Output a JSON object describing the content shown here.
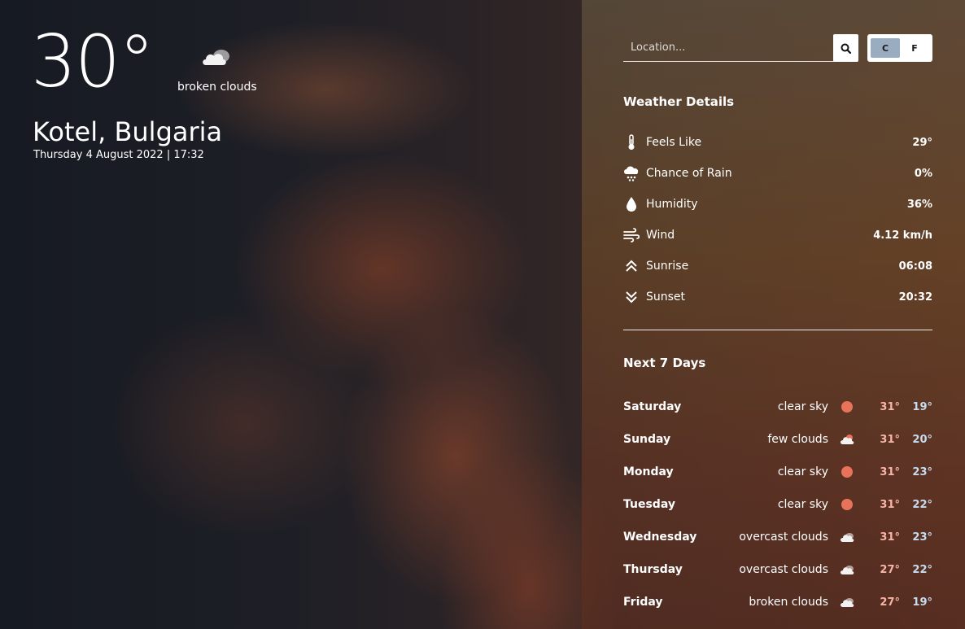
{
  "current": {
    "temperature": "30°",
    "condition": "broken clouds",
    "condition_icon": "cloud-icon",
    "location": "Kotel, Bulgaria",
    "datetime": "Thursday 4 August 2022 | 17:32"
  },
  "search": {
    "placeholder": "Location..."
  },
  "units": {
    "celsius": "C",
    "fahrenheit": "F",
    "active": "C",
    "active_color": "#9aacc0"
  },
  "details": {
    "title": "Weather Details",
    "items": [
      {
        "icon": "thermometer-icon",
        "label": "Feels Like",
        "value": "29°"
      },
      {
        "icon": "rain-cloud-icon",
        "label": "Chance of Rain",
        "value": "0%"
      },
      {
        "icon": "droplet-icon",
        "label": "Humidity",
        "value": "36%"
      },
      {
        "icon": "wind-icon",
        "label": "Wind",
        "value": "4.12 km/h"
      },
      {
        "icon": "sunrise-icon",
        "label": "Sunrise",
        "value": "06:08"
      },
      {
        "icon": "sunset-icon",
        "label": "Sunset",
        "value": "20:32"
      }
    ]
  },
  "forecast": {
    "title": "Next 7 Days",
    "high_color": "#f7b5a8",
    "low_color": "#c6dcf0",
    "days": [
      {
        "day": "Saturday",
        "desc": "clear sky",
        "icon": "sun-icon",
        "high": "31°",
        "low": "19°"
      },
      {
        "day": "Sunday",
        "desc": "few clouds",
        "icon": "partly-cloudy-icon",
        "high": "31°",
        "low": "20°"
      },
      {
        "day": "Monday",
        "desc": "clear sky",
        "icon": "sun-icon",
        "high": "31°",
        "low": "23°"
      },
      {
        "day": "Tuesday",
        "desc": "clear sky",
        "icon": "sun-icon",
        "high": "31°",
        "low": "22°"
      },
      {
        "day": "Wednesday",
        "desc": "overcast clouds",
        "icon": "cloud-icon",
        "high": "31°",
        "low": "23°"
      },
      {
        "day": "Thursday",
        "desc": "overcast clouds",
        "icon": "cloud-icon",
        "high": "27°",
        "low": "22°"
      },
      {
        "day": "Friday",
        "desc": "broken clouds",
        "icon": "cloud-icon",
        "high": "27°",
        "low": "19°"
      }
    ]
  }
}
